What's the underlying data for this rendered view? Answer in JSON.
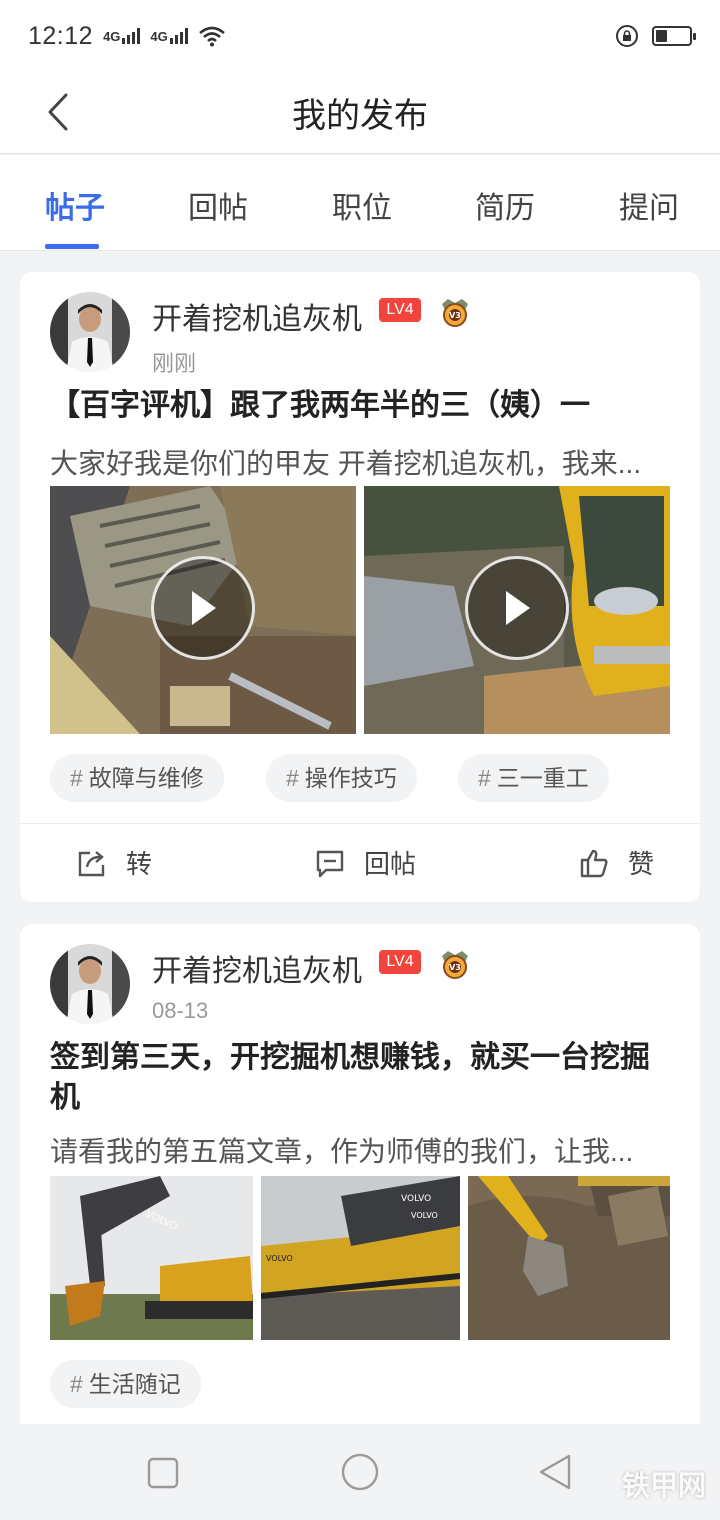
{
  "status_bar": {
    "time": "12:12",
    "network_1": "4G",
    "network_2": "4G"
  },
  "nav": {
    "title": "我的发布"
  },
  "tabs": [
    {
      "label": "帖子",
      "active": true
    },
    {
      "label": "回帖",
      "active": false
    },
    {
      "label": "职位",
      "active": false
    },
    {
      "label": "简历",
      "active": false
    },
    {
      "label": "提问",
      "active": false
    }
  ],
  "posts": [
    {
      "author": "开着挖机追灰机",
      "level": "LV4",
      "vip": "V3",
      "time": "刚刚",
      "title": "【百字评机】跟了我两年半的三（姨）一",
      "excerpt": "大家好我是你们的甲友 开着挖机追灰机，我来...",
      "media_type": "video",
      "tags": [
        "故障与维修",
        "操作技巧",
        "三一重工"
      ],
      "actions": {
        "share": "转",
        "reply": "回帖",
        "like": "赞"
      }
    },
    {
      "author": "开着挖机追灰机",
      "level": "LV4",
      "vip": "V3",
      "time": "08-13",
      "title": "签到第三天，开挖掘机想赚钱，就买一台挖掘机",
      "excerpt": "请看我的第五篇文章，作为师傅的我们，让我...",
      "media_type": "image",
      "image_text": "VOLVO",
      "tags": [
        "生活随记"
      ]
    }
  ],
  "watermark": "铁甲网",
  "colors": {
    "accent": "#3a6ee8",
    "level_badge": "#f0443c",
    "background": "#f2f3f5"
  }
}
